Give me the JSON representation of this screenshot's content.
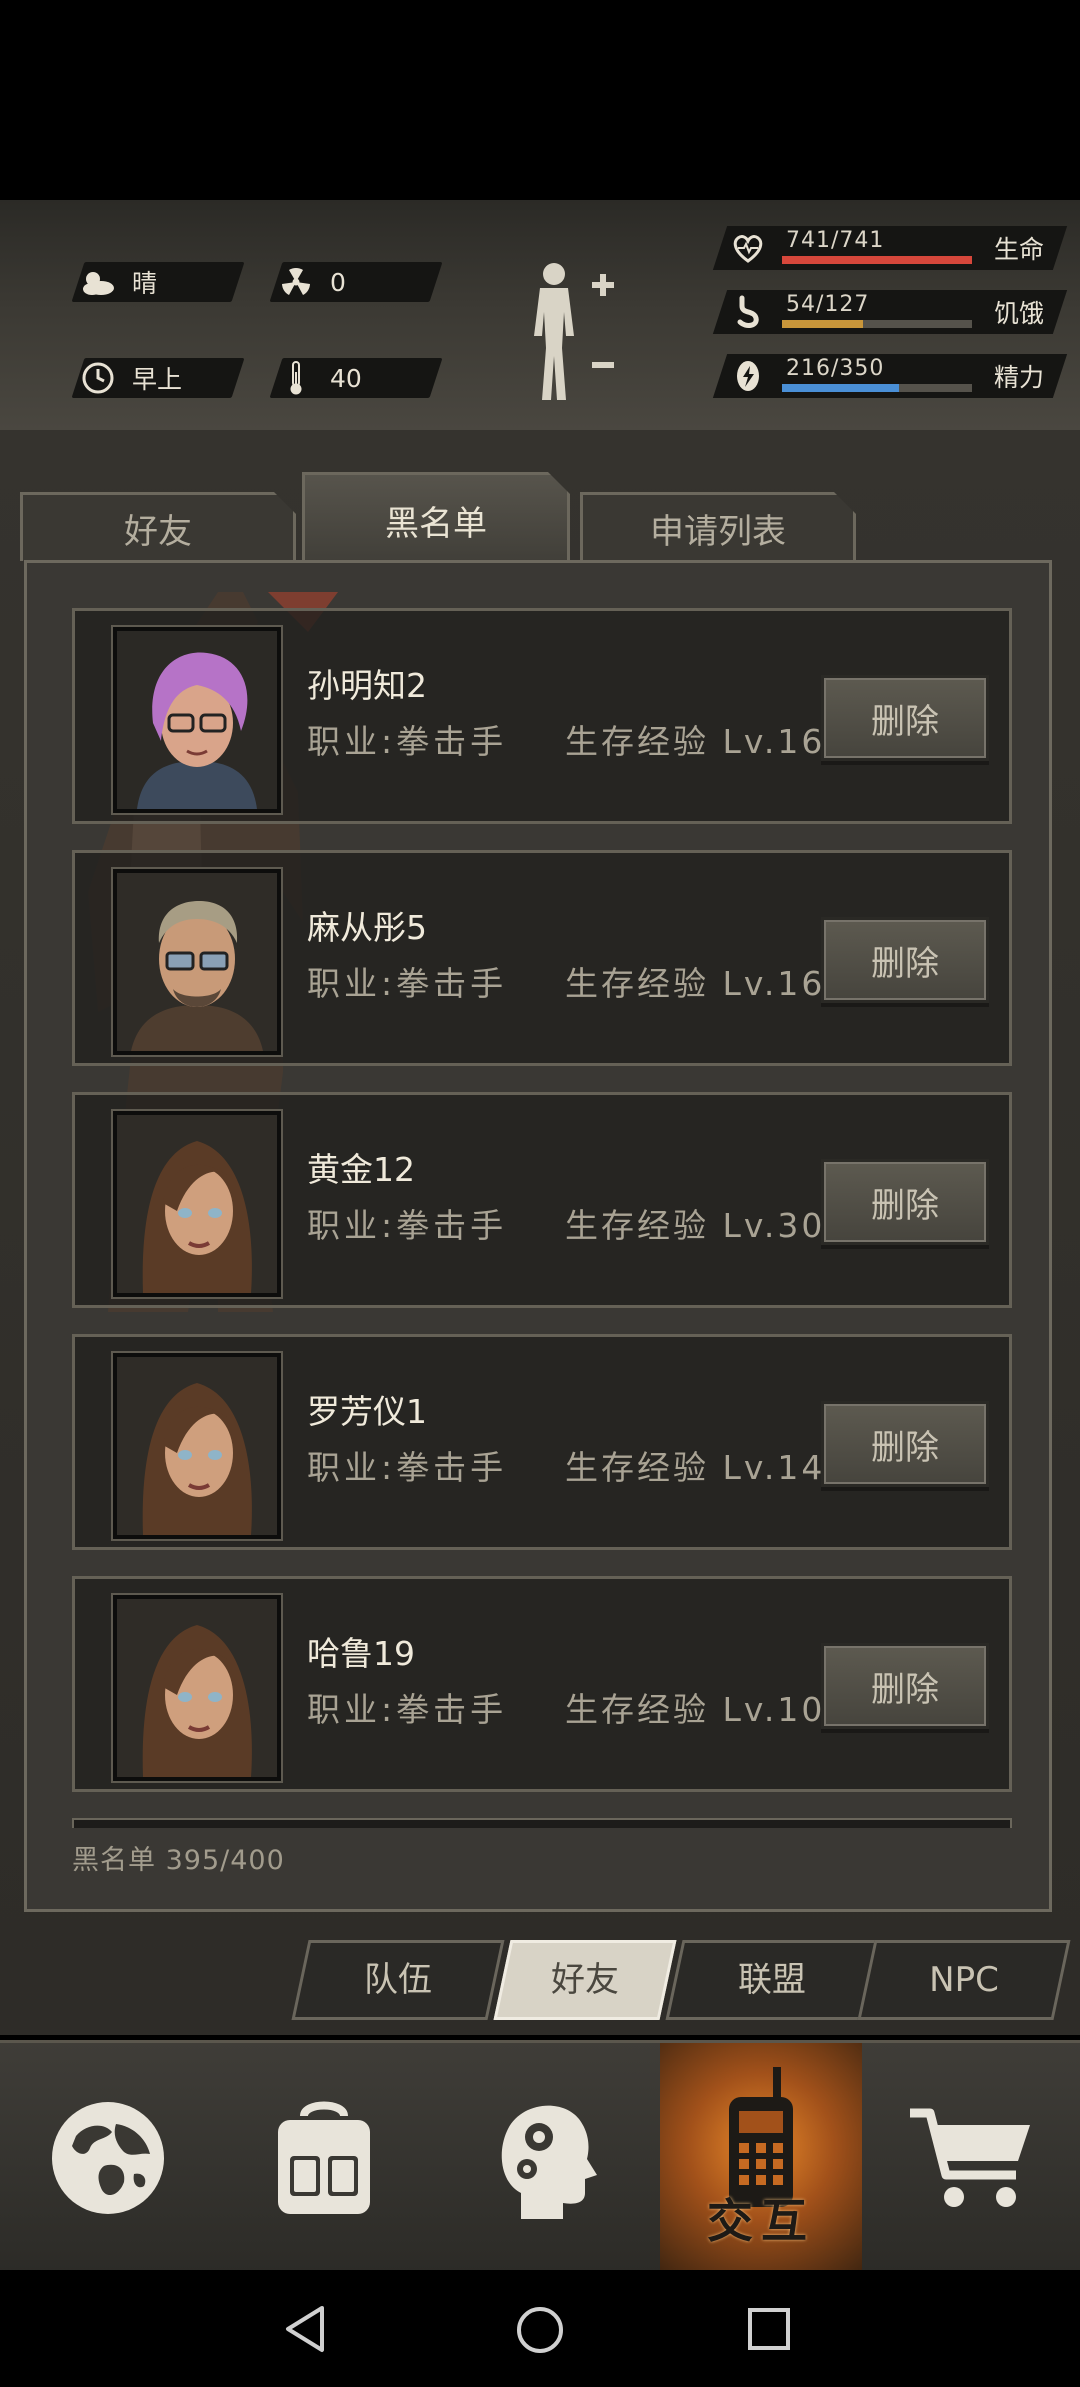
{
  "status": {
    "weather": "晴",
    "radiation": "0",
    "time_of_day": "早上",
    "temperature": "40",
    "stats": [
      {
        "label": "生命",
        "value": "741/741",
        "fraction": 1.0,
        "color": "#d6473b",
        "icon": "heart-icon"
      },
      {
        "label": "饥饿",
        "value": "54/127",
        "fraction": 0.425,
        "color": "#c9963a",
        "icon": "stomach-icon"
      },
      {
        "label": "精力",
        "value": "216/350",
        "fraction": 0.617,
        "color": "#4a8fd6",
        "icon": "energy-icon"
      }
    ]
  },
  "tabs": [
    {
      "label": "好友",
      "active": false
    },
    {
      "label": "黑名单",
      "active": true
    },
    {
      "label": "申请列表",
      "active": false
    }
  ],
  "blacklist": [
    {
      "name": "孙明知2",
      "job": "职业:拳击手",
      "exp": "生存经验 Lv.16",
      "button": "删除",
      "avatar": "purple-hair-glasses-avatar"
    },
    {
      "name": "麻从彤5",
      "job": "职业:拳击手",
      "exp": "生存经验 Lv.16",
      "button": "删除",
      "avatar": "bald-glasses-man-avatar"
    },
    {
      "name": "黄金12",
      "job": "职业:拳击手",
      "exp": "生存经验 Lv.30",
      "button": "删除",
      "avatar": "brown-hair-woman-avatar"
    },
    {
      "name": "罗芳仪1",
      "job": "职业:拳击手",
      "exp": "生存经验 Lv.14",
      "button": "删除",
      "avatar": "brown-hair-woman-avatar"
    },
    {
      "name": "哈鲁19",
      "job": "职业:拳击手",
      "exp": "生存经验 Lv.10",
      "button": "删除",
      "avatar": "brown-hair-woman-avatar"
    }
  ],
  "blacklist_count": "黑名单 395/400",
  "sub_tabs": [
    {
      "label": "队伍",
      "active": false
    },
    {
      "label": "好友",
      "active": true
    },
    {
      "label": "联盟",
      "active": false
    },
    {
      "label": "NPC",
      "active": false
    }
  ],
  "bottom_nav": [
    {
      "icon": "globe-icon",
      "label": ""
    },
    {
      "icon": "backpack-icon",
      "label": ""
    },
    {
      "icon": "skills-head-icon",
      "label": ""
    },
    {
      "icon": "walkie-talkie-icon",
      "label": "交互",
      "active": true
    },
    {
      "icon": "shopping-cart-icon",
      "label": ""
    }
  ],
  "colors": {
    "accent": "#e9892a",
    "hp": "#d6473b",
    "hunger": "#c9963a",
    "energy": "#4a8fd6"
  }
}
